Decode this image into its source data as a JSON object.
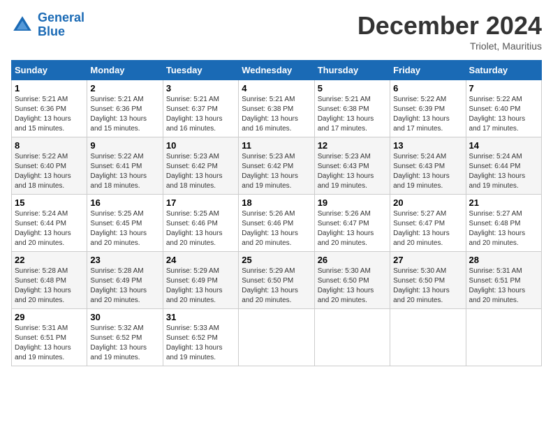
{
  "logo": {
    "general": "General",
    "blue": "Blue"
  },
  "header": {
    "month": "December 2024",
    "location": "Triolet, Mauritius"
  },
  "weekdays": [
    "Sunday",
    "Monday",
    "Tuesday",
    "Wednesday",
    "Thursday",
    "Friday",
    "Saturday"
  ],
  "weeks": [
    [
      {
        "day": "1",
        "sunrise": "5:21 AM",
        "sunset": "6:36 PM",
        "daylight": "13 hours and 15 minutes."
      },
      {
        "day": "2",
        "sunrise": "5:21 AM",
        "sunset": "6:36 PM",
        "daylight": "13 hours and 15 minutes."
      },
      {
        "day": "3",
        "sunrise": "5:21 AM",
        "sunset": "6:37 PM",
        "daylight": "13 hours and 16 minutes."
      },
      {
        "day": "4",
        "sunrise": "5:21 AM",
        "sunset": "6:38 PM",
        "daylight": "13 hours and 16 minutes."
      },
      {
        "day": "5",
        "sunrise": "5:21 AM",
        "sunset": "6:38 PM",
        "daylight": "13 hours and 17 minutes."
      },
      {
        "day": "6",
        "sunrise": "5:22 AM",
        "sunset": "6:39 PM",
        "daylight": "13 hours and 17 minutes."
      },
      {
        "day": "7",
        "sunrise": "5:22 AM",
        "sunset": "6:40 PM",
        "daylight": "13 hours and 17 minutes."
      }
    ],
    [
      {
        "day": "8",
        "sunrise": "5:22 AM",
        "sunset": "6:40 PM",
        "daylight": "13 hours and 18 minutes."
      },
      {
        "day": "9",
        "sunrise": "5:22 AM",
        "sunset": "6:41 PM",
        "daylight": "13 hours and 18 minutes."
      },
      {
        "day": "10",
        "sunrise": "5:23 AM",
        "sunset": "6:42 PM",
        "daylight": "13 hours and 18 minutes."
      },
      {
        "day": "11",
        "sunrise": "5:23 AM",
        "sunset": "6:42 PM",
        "daylight": "13 hours and 19 minutes."
      },
      {
        "day": "12",
        "sunrise": "5:23 AM",
        "sunset": "6:43 PM",
        "daylight": "13 hours and 19 minutes."
      },
      {
        "day": "13",
        "sunrise": "5:24 AM",
        "sunset": "6:43 PM",
        "daylight": "13 hours and 19 minutes."
      },
      {
        "day": "14",
        "sunrise": "5:24 AM",
        "sunset": "6:44 PM",
        "daylight": "13 hours and 19 minutes."
      }
    ],
    [
      {
        "day": "15",
        "sunrise": "5:24 AM",
        "sunset": "6:44 PM",
        "daylight": "13 hours and 20 minutes."
      },
      {
        "day": "16",
        "sunrise": "5:25 AM",
        "sunset": "6:45 PM",
        "daylight": "13 hours and 20 minutes."
      },
      {
        "day": "17",
        "sunrise": "5:25 AM",
        "sunset": "6:46 PM",
        "daylight": "13 hours and 20 minutes."
      },
      {
        "day": "18",
        "sunrise": "5:26 AM",
        "sunset": "6:46 PM",
        "daylight": "13 hours and 20 minutes."
      },
      {
        "day": "19",
        "sunrise": "5:26 AM",
        "sunset": "6:47 PM",
        "daylight": "13 hours and 20 minutes."
      },
      {
        "day": "20",
        "sunrise": "5:27 AM",
        "sunset": "6:47 PM",
        "daylight": "13 hours and 20 minutes."
      },
      {
        "day": "21",
        "sunrise": "5:27 AM",
        "sunset": "6:48 PM",
        "daylight": "13 hours and 20 minutes."
      }
    ],
    [
      {
        "day": "22",
        "sunrise": "5:28 AM",
        "sunset": "6:48 PM",
        "daylight": "13 hours and 20 minutes."
      },
      {
        "day": "23",
        "sunrise": "5:28 AM",
        "sunset": "6:49 PM",
        "daylight": "13 hours and 20 minutes."
      },
      {
        "day": "24",
        "sunrise": "5:29 AM",
        "sunset": "6:49 PM",
        "daylight": "13 hours and 20 minutes."
      },
      {
        "day": "25",
        "sunrise": "5:29 AM",
        "sunset": "6:50 PM",
        "daylight": "13 hours and 20 minutes."
      },
      {
        "day": "26",
        "sunrise": "5:30 AM",
        "sunset": "6:50 PM",
        "daylight": "13 hours and 20 minutes."
      },
      {
        "day": "27",
        "sunrise": "5:30 AM",
        "sunset": "6:50 PM",
        "daylight": "13 hours and 20 minutes."
      },
      {
        "day": "28",
        "sunrise": "5:31 AM",
        "sunset": "6:51 PM",
        "daylight": "13 hours and 20 minutes."
      }
    ],
    [
      {
        "day": "29",
        "sunrise": "5:31 AM",
        "sunset": "6:51 PM",
        "daylight": "13 hours and 19 minutes."
      },
      {
        "day": "30",
        "sunrise": "5:32 AM",
        "sunset": "6:52 PM",
        "daylight": "13 hours and 19 minutes."
      },
      {
        "day": "31",
        "sunrise": "5:33 AM",
        "sunset": "6:52 PM",
        "daylight": "13 hours and 19 minutes."
      },
      null,
      null,
      null,
      null
    ]
  ]
}
